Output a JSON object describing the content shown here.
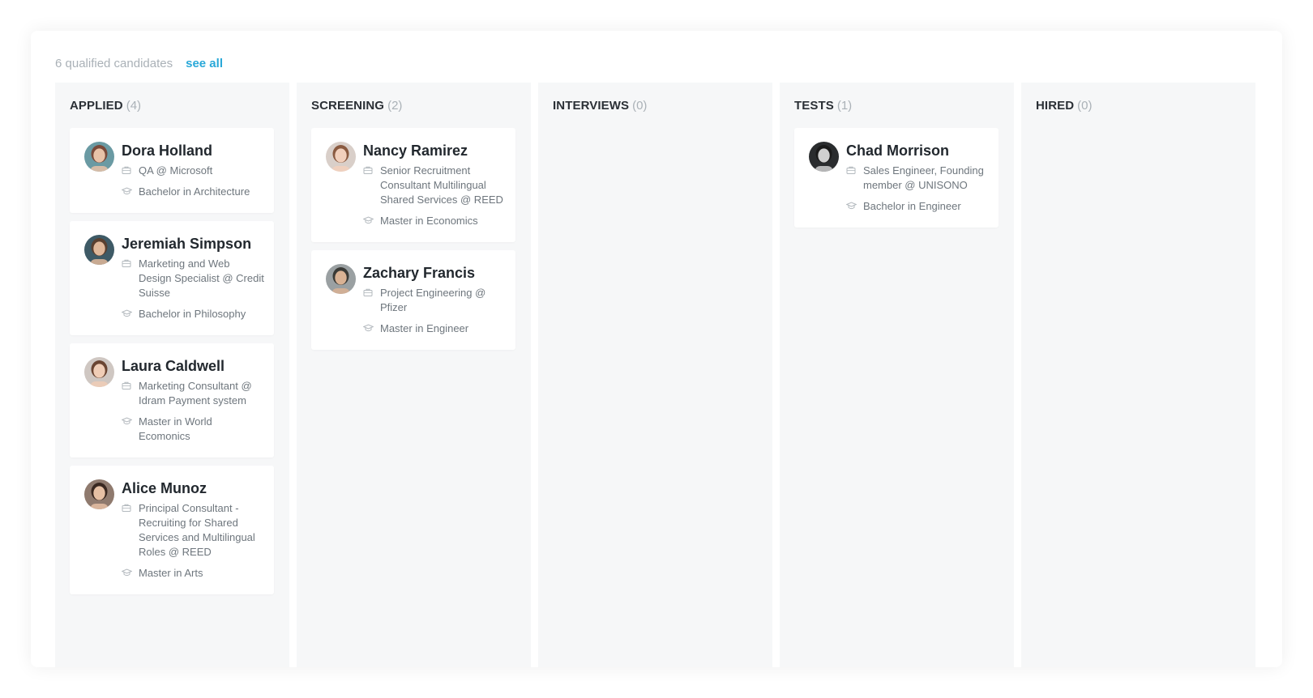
{
  "header": {
    "qualified_text": "6 qualified candidates",
    "see_all_label": "see all"
  },
  "colors": {
    "accent": "#29a8d8",
    "column_bg": "#f6f7f8",
    "muted_text": "#aab1b7"
  },
  "columns": [
    {
      "title": "APPLIED",
      "count": "(4)",
      "cards": [
        {
          "name": "Dora Holland",
          "job": "QA @ Microsoft",
          "education": "Bachelor in Architecture",
          "avatar": {
            "bg": "#6a9aa3",
            "skin": "#e8c2a8",
            "hair": "#7a4a3a"
          }
        },
        {
          "name": "Jeremiah Simpson",
          "job": "Marketing and Web Design Specialist @ Credit Suisse",
          "education": "Bachelor in Philosophy",
          "avatar": {
            "bg": "#3e5a66",
            "skin": "#e0b89a",
            "hair": "#5a4030"
          }
        },
        {
          "name": "Laura Caldwell",
          "job": "Marketing Consultant @ Idram Payment system",
          "education": "Master in World Ecomonics",
          "avatar": {
            "bg": "#cfc7c2",
            "skin": "#f0cdb6",
            "hair": "#6b4532"
          }
        },
        {
          "name": "Alice Munoz",
          "job": "Principal Consultant - Recruiting for Shared Services and Multilingual Roles @ REED",
          "education": "Master in Arts",
          "avatar": {
            "bg": "#8f7a6e",
            "skin": "#e6c0a4",
            "hair": "#3a2820"
          }
        }
      ]
    },
    {
      "title": "SCREENING",
      "count": "(2)",
      "cards": [
        {
          "name": "Nancy Ramirez",
          "job": "Senior Recruitment Consultant Multilingual Shared Services @ REED",
          "education": "Master in Economics",
          "avatar": {
            "bg": "#d9cfc9",
            "skin": "#f2d0bc",
            "hair": "#8a5a40"
          }
        },
        {
          "name": "Zachary Francis",
          "job": "Project Engineering @ Pfizer",
          "education": "Master in Engineer",
          "avatar": {
            "bg": "#9aa0a2",
            "skin": "#d9b294",
            "hair": "#3a3a36"
          }
        }
      ]
    },
    {
      "title": "INTERVIEWS",
      "count": "(0)",
      "cards": []
    },
    {
      "title": "TESTS",
      "count": "(1)",
      "cards": [
        {
          "name": "Chad Morrison",
          "job": "Sales Engineer, Founding member @ UNISONO",
          "education": "Bachelor in Engineer",
          "avatar": {
            "bg": "#2a2c2e",
            "skin": "#cfcfcf",
            "hair": "#1a1a1a"
          }
        }
      ]
    },
    {
      "title": "HIRED",
      "count": "(0)",
      "cards": []
    }
  ]
}
